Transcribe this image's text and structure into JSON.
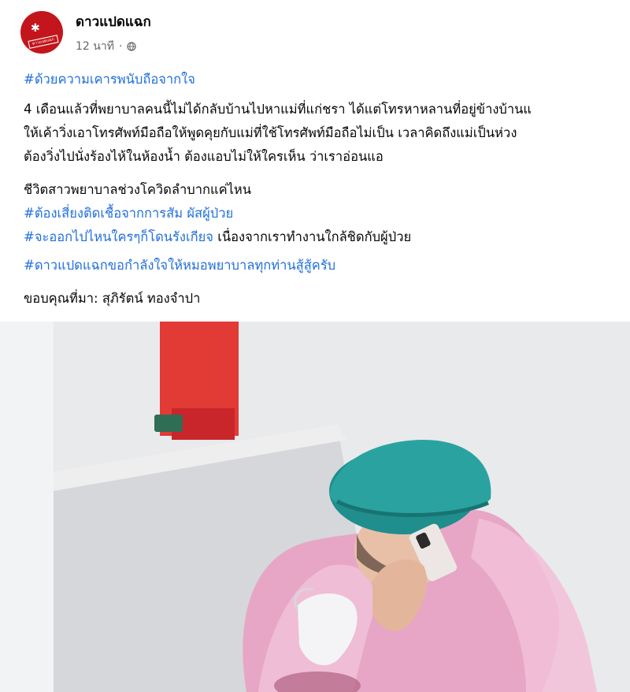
{
  "page": {
    "name": "ดาวแปดแฉก",
    "time": "12 นาที",
    "avatar_text": "ดาวแปดแฉก"
  },
  "post": {
    "hashtag1": "#ด้วยความเคารพนับถือจากใจ",
    "para1": [
      "4 เดือนแล้วที่พยาบาลคนนี้ไม่ได้กลับบ้านไปหาแม่ที่แก่ชรา  ได้แต่โทรหาหลานที่อยู่ข้างบ้านแ",
      "ให้เค้าวิ่งเอาโทรศัพท์มือถือให้พูดคุยกับแม่ที่ใช้โทรศัพท์มือถือไม่เป็น   เวลาคิดถึงแม่เป็นห่วง",
      "ต้องวิ่งไปนั่งร้องไห้ในห้องน้ำ  ต้องแอบไม่ให้ใครเห็น ว่าเราอ่อนแอ"
    ],
    "line2": "ชีวิตสาวพยาบาลช่วงโควิดลำบากแค่ไหน",
    "hashtag2": "#ต้องเสี่ยงติดเชื้อจากการสัม ผัสผู้ป่วย",
    "hashtag3": "#จะออกไปไหนใครๆก็โดนรังเกียจ",
    "line3_rest": " เนื่องจากเราทำงานใกล้ชิดกับผู้ป่วย",
    "hashtag4": "#ดาวแปดแฉกขอกำลังใจให้หมอพยาบาลทุกท่านสู้สู้ครับ",
    "credit": "ขอบคุณที่มา: สุภิรัตน์ ทองจำปา"
  },
  "colors": {
    "hashtag": "#216fdb",
    "text": "#050505",
    "meta": "#65676b",
    "avatar": "#c3161c"
  },
  "icons": {
    "privacy": "globe-icon"
  }
}
